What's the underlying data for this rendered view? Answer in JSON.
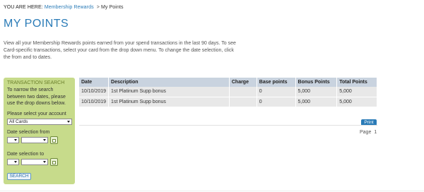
{
  "breadcrumb": {
    "prefix": "YOU ARE HERE:",
    "link": "Membership Rewards",
    "separator": ">",
    "current": "My Points"
  },
  "page": {
    "title": "MY POINTS",
    "intro": "View all your Membership Rewards points earned from your spend transactions in the last 90 days. To see Card-specific transactions, select your card from the drop down menu. To change the date selection, click the from and to dates."
  },
  "sidebar": {
    "title": "TRANSACTION SEARCH",
    "help": "To narrow the search between two dates, please use the drop downs below.",
    "account_label": "Please select your account",
    "account_value": "All Cards",
    "from_label": "Date selection from",
    "to_label": "Date selection to",
    "search_label": "SEARCH"
  },
  "table": {
    "headers": [
      "Date",
      "Description",
      "Charge",
      "Base points",
      "Bonus Points",
      "Total Points"
    ],
    "rows": [
      [
        "10/10/2019",
        "1st Platinum Supp bonus",
        "",
        "0",
        "5,000",
        "5,000"
      ],
      [
        "10/10/2019",
        "1st Platinum Supp bonus",
        "",
        "0",
        "5,000",
        "5,000"
      ]
    ]
  },
  "actions": {
    "print_label": "Print",
    "page_label": "Page",
    "page_number": "1"
  },
  "colors": {
    "accent": "#2a7bb7",
    "sidebar_bg": "#c7db8b",
    "table_header": "#c9d3df",
    "table_row": "#e8e8e8"
  }
}
